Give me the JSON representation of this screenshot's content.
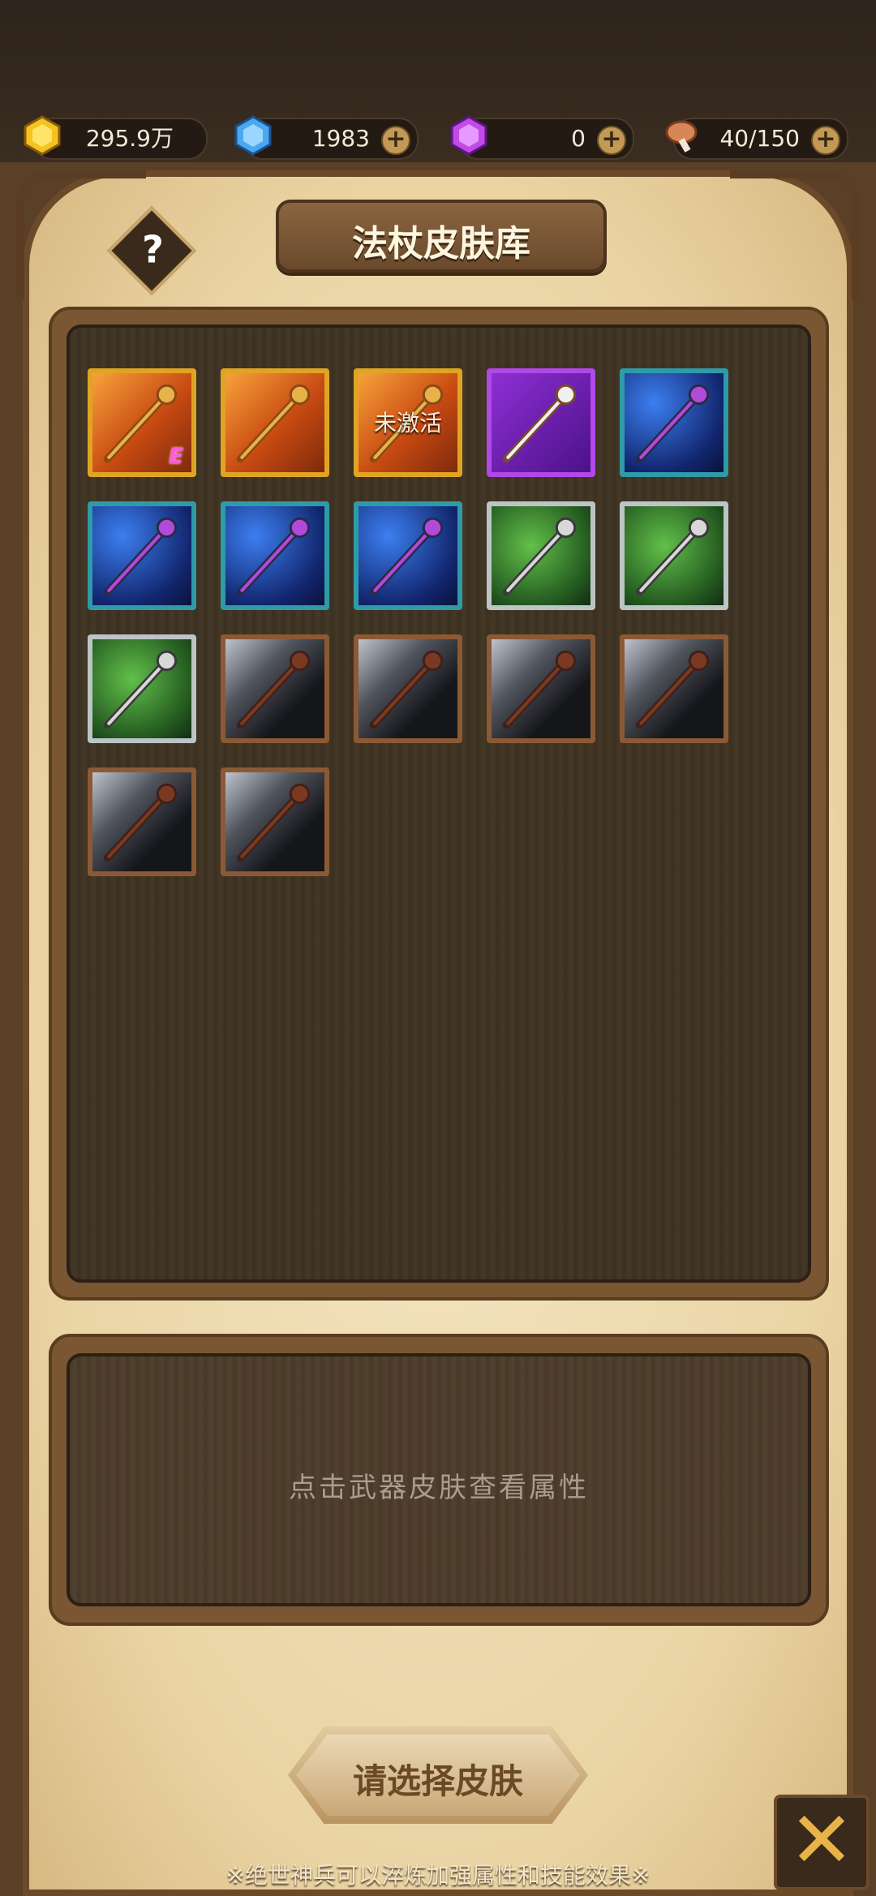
{
  "resources": {
    "gold": "295.9万",
    "diamond": "1983",
    "crystal": "0",
    "stamina": "40/150"
  },
  "title": "法杖皮肤库",
  "help_label": "?",
  "skins": [
    {
      "rarity": "gold",
      "badge": "E",
      "status": ""
    },
    {
      "rarity": "gold",
      "badge": "",
      "status": ""
    },
    {
      "rarity": "gold",
      "badge": "",
      "status": "未激活"
    },
    {
      "rarity": "purple",
      "badge": "",
      "status": ""
    },
    {
      "rarity": "blue",
      "badge": "",
      "status": ""
    },
    {
      "rarity": "blue",
      "badge": "",
      "status": ""
    },
    {
      "rarity": "blue",
      "badge": "",
      "status": ""
    },
    {
      "rarity": "blue",
      "badge": "",
      "status": ""
    },
    {
      "rarity": "green",
      "badge": "",
      "status": ""
    },
    {
      "rarity": "green",
      "badge": "",
      "status": ""
    },
    {
      "rarity": "green",
      "badge": "",
      "status": ""
    },
    {
      "rarity": "grey",
      "badge": "",
      "status": ""
    },
    {
      "rarity": "grey",
      "badge": "",
      "status": ""
    },
    {
      "rarity": "grey",
      "badge": "",
      "status": ""
    },
    {
      "rarity": "grey",
      "badge": "",
      "status": ""
    },
    {
      "rarity": "grey",
      "badge": "",
      "status": ""
    },
    {
      "rarity": "grey",
      "badge": "",
      "status": ""
    }
  ],
  "info_hint": "点击武器皮肤查看属性",
  "select_button": "请选择皮肤",
  "footer_note": "※绝世神兵可以淬炼加强属性和技能效果※",
  "close_label": "✕"
}
